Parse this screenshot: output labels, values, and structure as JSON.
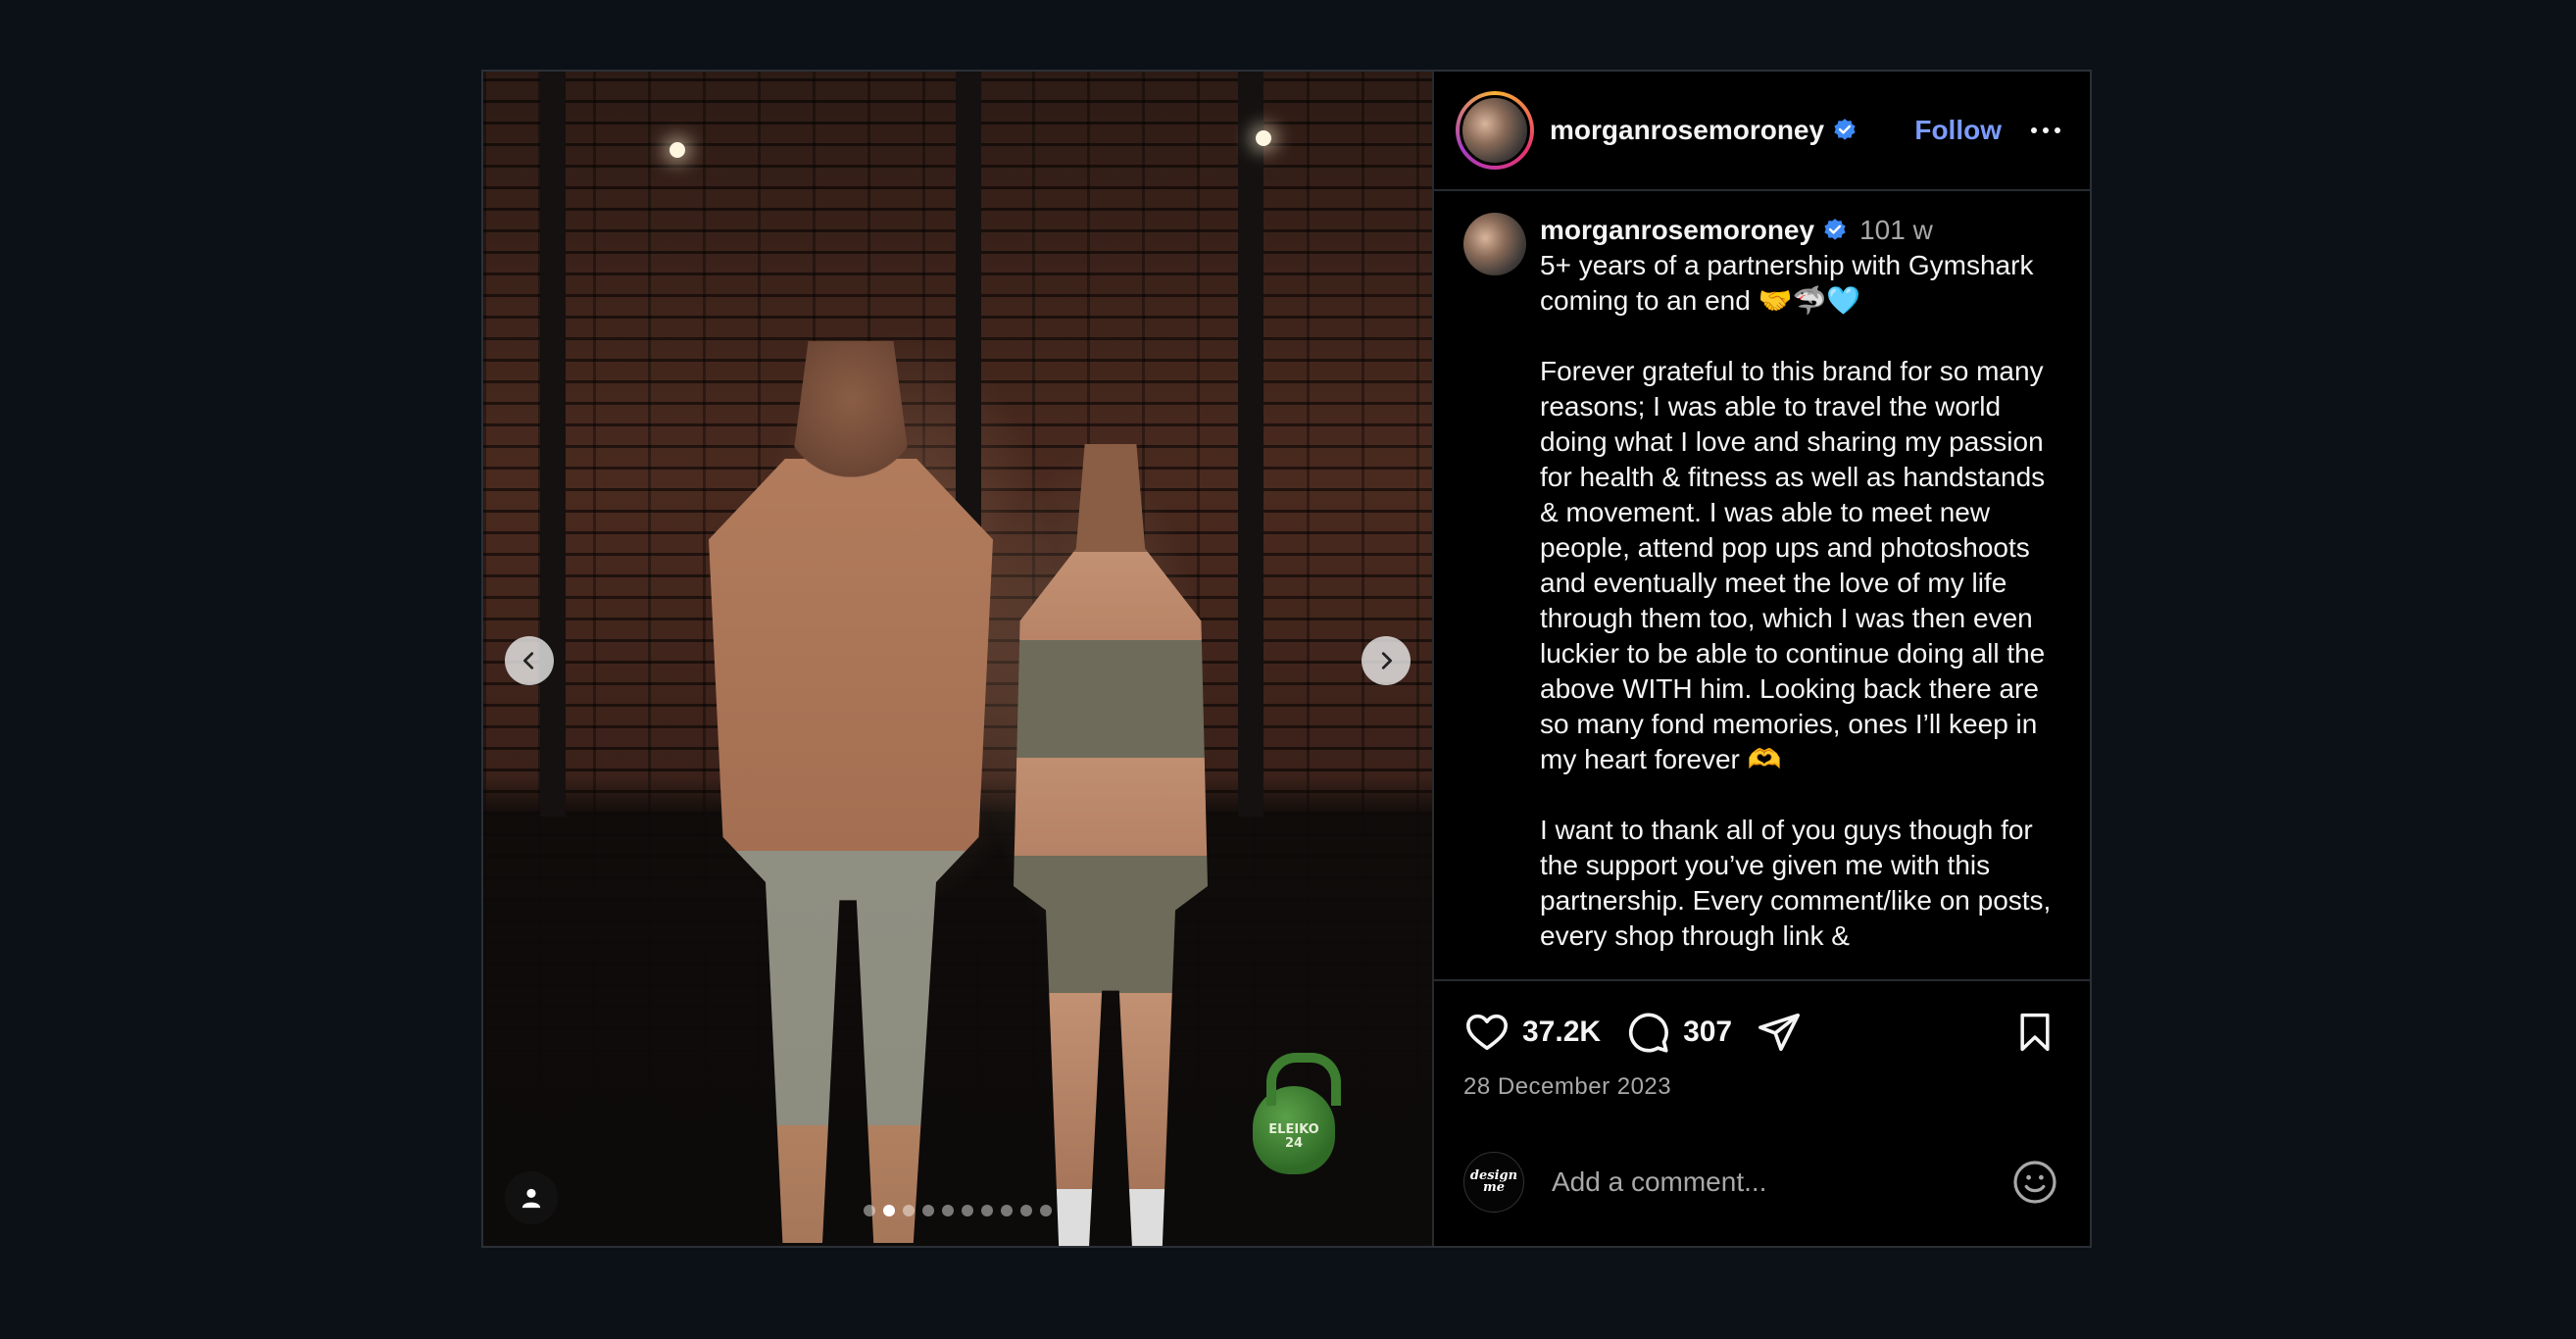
{
  "post": {
    "username": "morganrosemoroney",
    "follow_label": "Follow",
    "carousel": {
      "total": 10,
      "active_index": 1
    },
    "kettlebell_text": "ELEIKO\n24"
  },
  "caption": {
    "username": "morganrosemoroney",
    "time": "101 w",
    "text": "5+ years of a partnership with Gymshark coming to an end 🤝🦈🩵\n\nForever grateful to this brand for so many reasons; I was able to travel the world doing what I love and sharing my passion for health & fitness as well as handstands & movement. I was able to meet new people, attend pop ups and photoshoots and eventually meet the love of my life through them too, which I was then even luckier to be able to continue doing all the above WITH him. Looking back there are so many fond memories, ones I’ll keep in my heart forever 🫶\n\nI want to thank all of you guys though for the support you’ve given me with this partnership. Every comment/like on posts, every shop through link &"
  },
  "stats": {
    "likes": "37.2K",
    "comments": "307",
    "date": "28 December 2023"
  },
  "comment_box": {
    "placeholder": "Add a comment...",
    "avatar_text": "design me"
  },
  "icons": [
    "chevron-left-icon",
    "chevron-right-icon",
    "user-tag-icon",
    "verified-badge-icon",
    "more-icon",
    "heart-icon",
    "comment-icon",
    "share-icon",
    "bookmark-icon",
    "emoji-icon"
  ],
  "colors": {
    "accent": "#7c9cff",
    "verified": "#3d8af7",
    "background": "#0b1116"
  }
}
